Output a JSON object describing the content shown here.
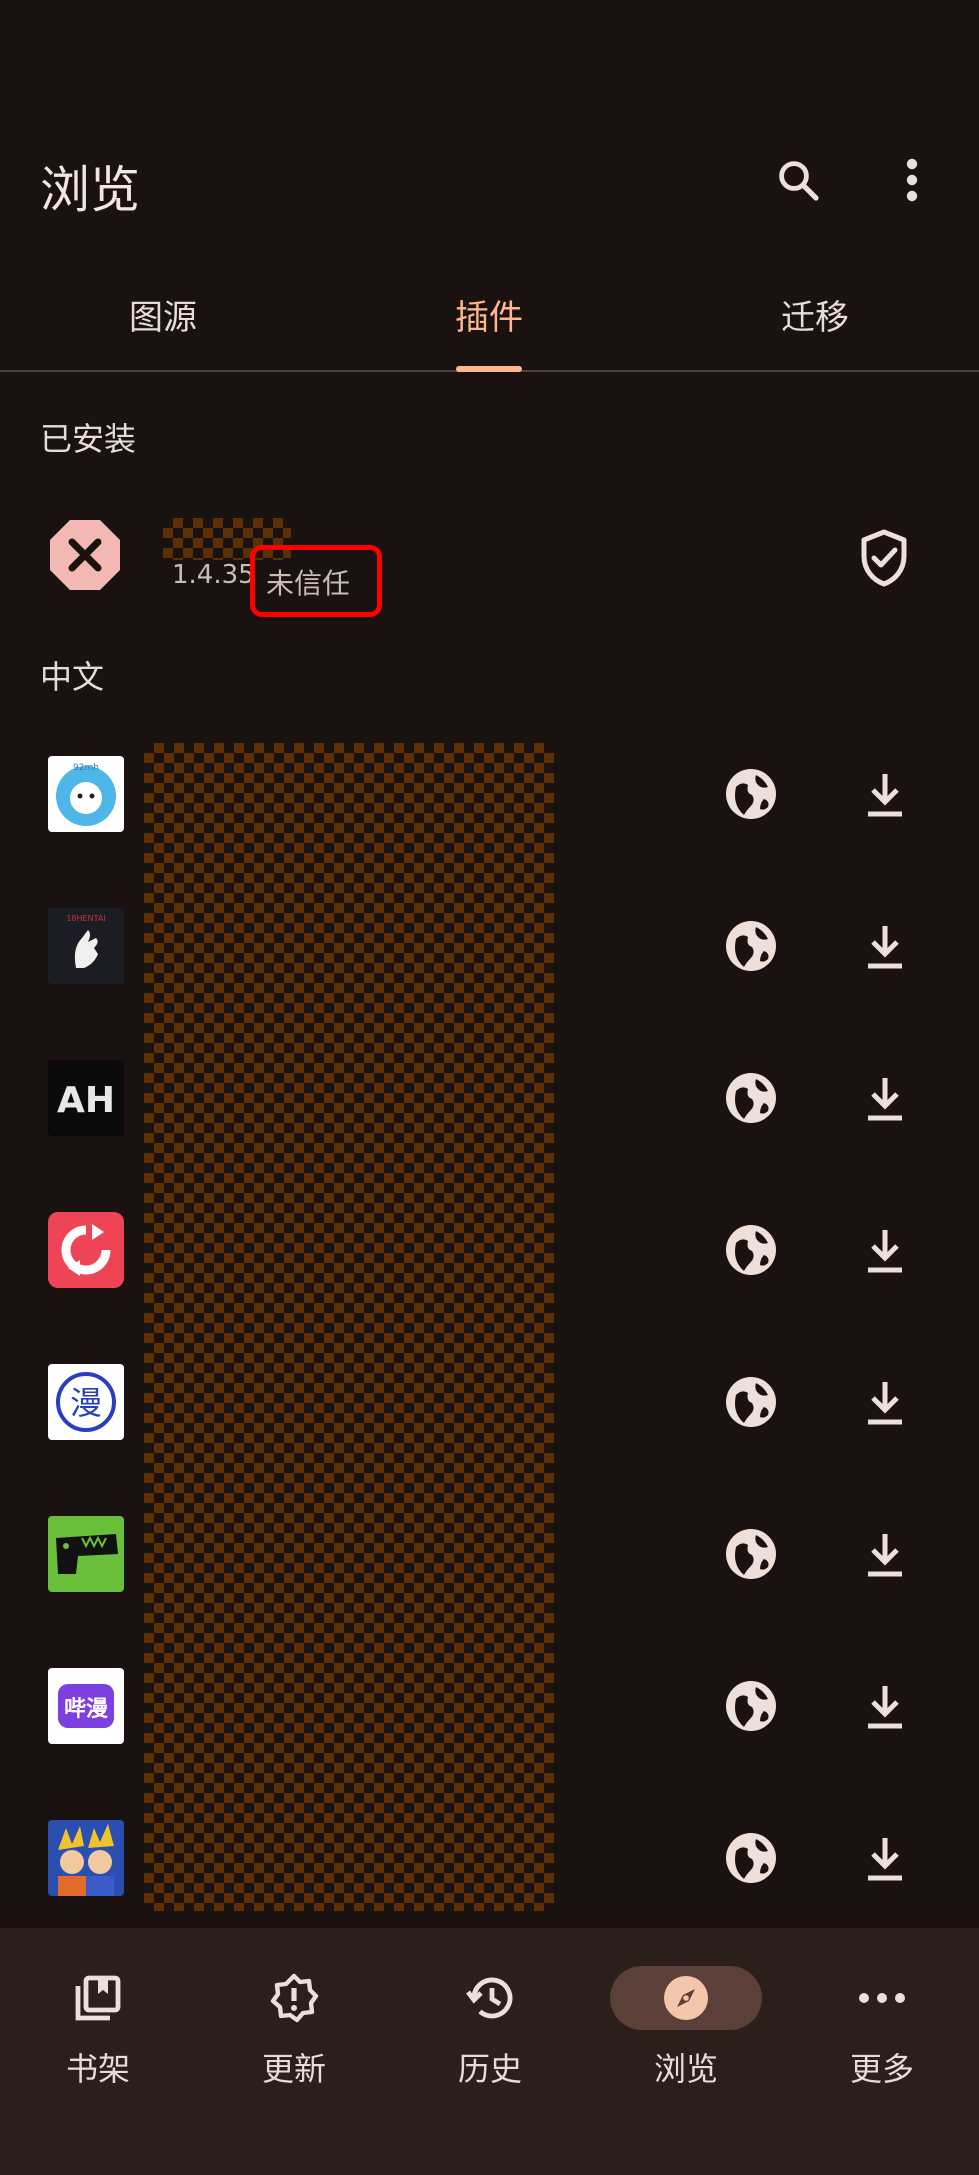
{
  "header": {
    "title": "浏览",
    "search_icon": "search-icon",
    "menu_icon": "more-vert-icon"
  },
  "tabs": [
    {
      "label": "图源"
    },
    {
      "label": "插件"
    },
    {
      "label": "迁移"
    }
  ],
  "active_tab": "插件",
  "installed": {
    "heading": "已安装",
    "item": {
      "version": "1.4.35",
      "trust_status": "未信任"
    }
  },
  "available": {
    "heading": "中文",
    "items": [
      {
        "logo_text": "92mh"
      },
      {
        "logo_text": "18HENTAI"
      },
      {
        "logo_text": "AH"
      },
      {
        "logo_text": ""
      },
      {
        "logo_text": "漫"
      },
      {
        "logo_text": ""
      },
      {
        "logo_text": "哔漫"
      },
      {
        "logo_text": ""
      }
    ]
  },
  "bottom_nav": [
    {
      "label": "书架",
      "icon": "library-icon"
    },
    {
      "label": "更新",
      "icon": "updates-icon"
    },
    {
      "label": "历史",
      "icon": "history-icon"
    },
    {
      "label": "浏览",
      "icon": "explore-icon"
    },
    {
      "label": "更多",
      "icon": "more-horiz-icon"
    }
  ],
  "colors": {
    "background": "#1a1210",
    "accent": "#ffb68f",
    "nav_bg": "#2a1f1b",
    "highlight_box": "#ff0000"
  }
}
